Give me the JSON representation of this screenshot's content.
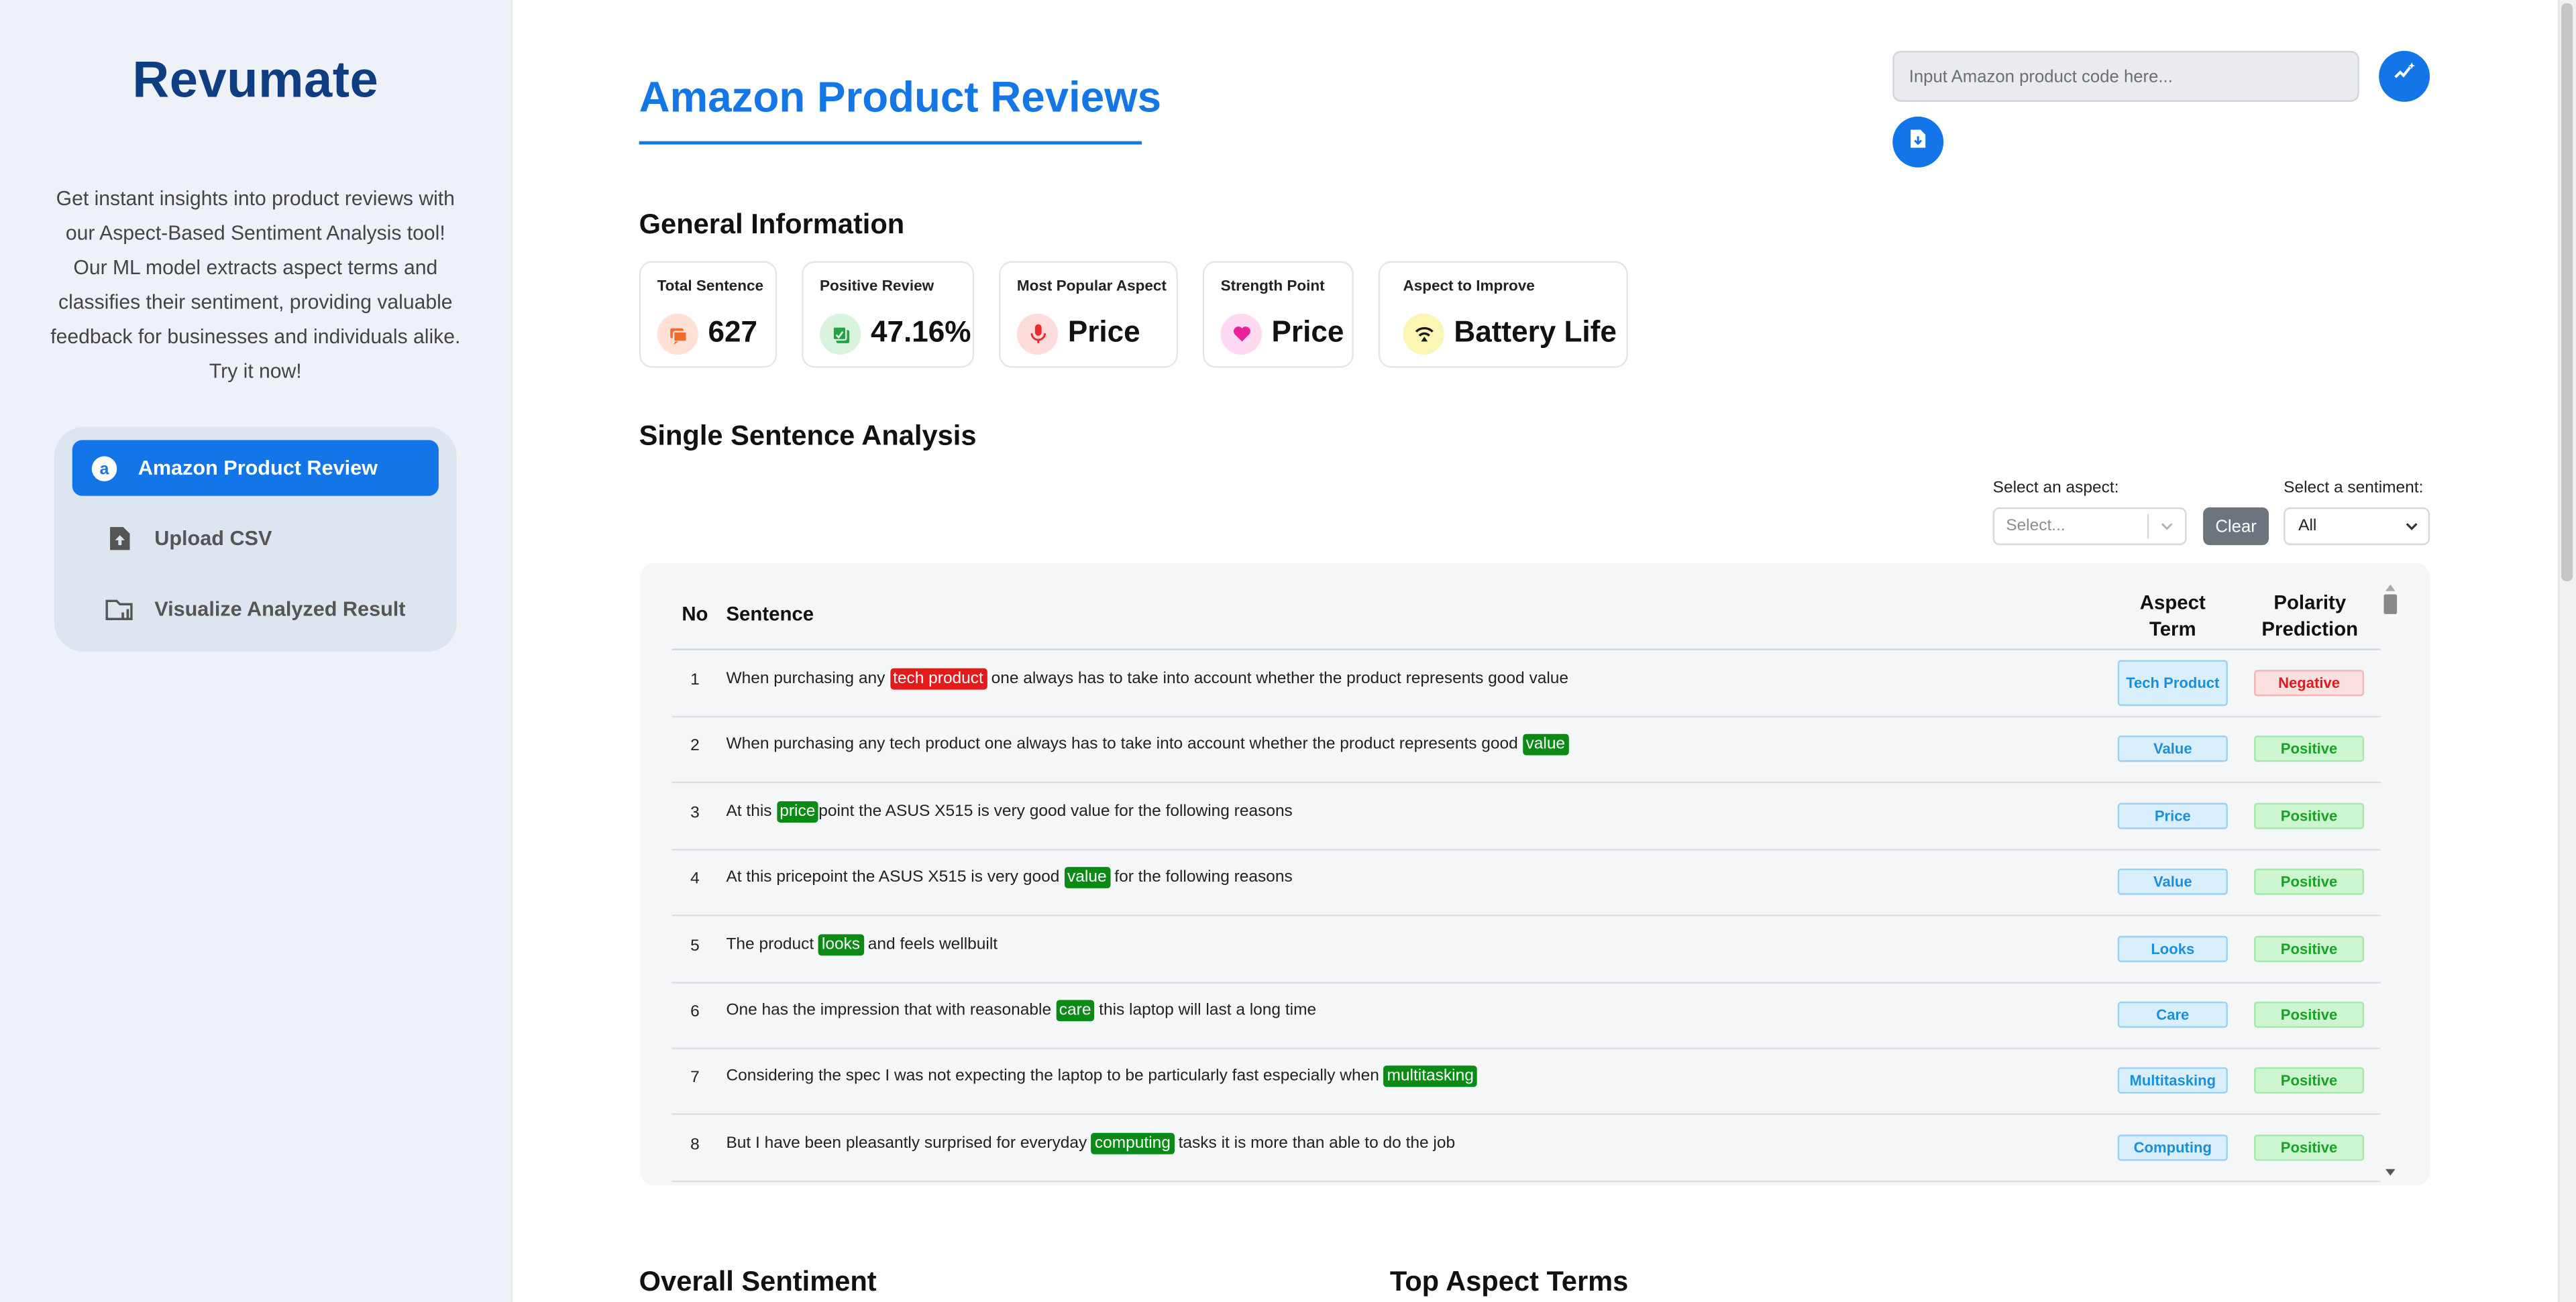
{
  "sidebar": {
    "brand": "Revumate",
    "tagline": "Get instant insights into product reviews with our Aspect-Based Sentiment Analysis tool! Our ML model extracts aspect terms and classifies their sentiment, providing valuable feedback for businesses and individuals alike. Try it now!",
    "menu": [
      {
        "label": "Amazon Product Review",
        "icon": "amazon-icon",
        "active": true
      },
      {
        "label": "Upload CSV",
        "icon": "file-upload-icon",
        "active": false
      },
      {
        "label": "Visualize Analyzed Result",
        "icon": "folder-chart-icon",
        "active": false
      }
    ]
  },
  "header": {
    "title": "Amazon Product Reviews",
    "search_placeholder": "Input Amazon product code here...",
    "search_value": "",
    "analyze_icon": "sparkle-analyze-icon",
    "download_icon": "download-file-icon"
  },
  "general": {
    "heading": "General Information",
    "cards": [
      {
        "label": "Total Sentence",
        "value": "627",
        "icon": "chat-icon",
        "icon_bg": "#ffe1d6",
        "icon_color": "#f26a2a"
      },
      {
        "label": "Positive Review",
        "value": "47.16%",
        "icon": "thumbs-up-icon",
        "icon_bg": "#d8f3de",
        "icon_color": "#22a547"
      },
      {
        "label": "Most Popular Aspect",
        "value": "Price",
        "icon": "microphone-icon",
        "icon_bg": "#ffdcdc",
        "icon_color": "#ef2a2a"
      },
      {
        "label": "Strength Point",
        "value": "Price",
        "icon": "heart-icon",
        "icon_bg": "#ffd8f2",
        "icon_color": "#e8229b"
      },
      {
        "label": "Aspect to Improve",
        "value": "Battery Life",
        "icon": "signal-icon",
        "icon_bg": "#fbf6b4",
        "icon_color": "#1a1a1a"
      }
    ]
  },
  "single": {
    "heading": "Single Sentence Analysis",
    "aspect_filter_label": "Select an aspect:",
    "aspect_placeholder": "Select...",
    "clear_label": "Clear",
    "sentiment_filter_label": "Select a sentiment:",
    "sentiment_value": "All",
    "columns": {
      "no": "No",
      "sentence": "Sentence",
      "aspect_1": "Aspect",
      "aspect_2": "Term",
      "polarity_1": "Polarity",
      "polarity_2": "Prediction"
    },
    "rows": [
      {
        "no": "1",
        "pre": "When purchasing any ",
        "term": "tech product",
        "post": " one always has to take into account whether the product represents good value",
        "aspect": "Tech Product",
        "polarity": "Negative",
        "sentiment": "neg"
      },
      {
        "no": "2",
        "pre": "When purchasing any tech product one always has to take into account whether the product represents good ",
        "term": "value",
        "post": "",
        "aspect": "Value",
        "polarity": "Positive",
        "sentiment": "pos"
      },
      {
        "no": "3",
        "pre": "At this ",
        "term": "price",
        "post": "point the ASUS X515 is very good value for the following reasons",
        "aspect": "Price",
        "polarity": "Positive",
        "sentiment": "pos"
      },
      {
        "no": "4",
        "pre": "At this pricepoint the ASUS X515 is very good ",
        "term": "value",
        "post": " for the following reasons",
        "aspect": "Value",
        "polarity": "Positive",
        "sentiment": "pos"
      },
      {
        "no": "5",
        "pre": "The product ",
        "term": "looks",
        "post": " and feels wellbuilt",
        "aspect": "Looks",
        "polarity": "Positive",
        "sentiment": "pos"
      },
      {
        "no": "6",
        "pre": "One has the impression that with reasonable ",
        "term": "care",
        "post": " this laptop will last a long time",
        "aspect": "Care",
        "polarity": "Positive",
        "sentiment": "pos"
      },
      {
        "no": "7",
        "pre": "Considering the spec I was not expecting the laptop to be particularly fast especially when ",
        "term": "multitasking",
        "post": "",
        "aspect": "Multitasking",
        "polarity": "Positive",
        "sentiment": "pos"
      },
      {
        "no": "8",
        "pre": "But I have been pleasantly surprised for everyday ",
        "term": "computing",
        "post": " tasks it is more than able to do the job",
        "aspect": "Computing",
        "polarity": "Positive",
        "sentiment": "pos"
      }
    ]
  },
  "bottom": {
    "overall_heading": "Overall Sentiment",
    "top_aspects_heading": "Top Aspect Terms"
  },
  "colors": {
    "accent": "#1275e8",
    "brand": "#0f3d82",
    "negative": "#e41b1b",
    "positive": "#0c8a16"
  }
}
